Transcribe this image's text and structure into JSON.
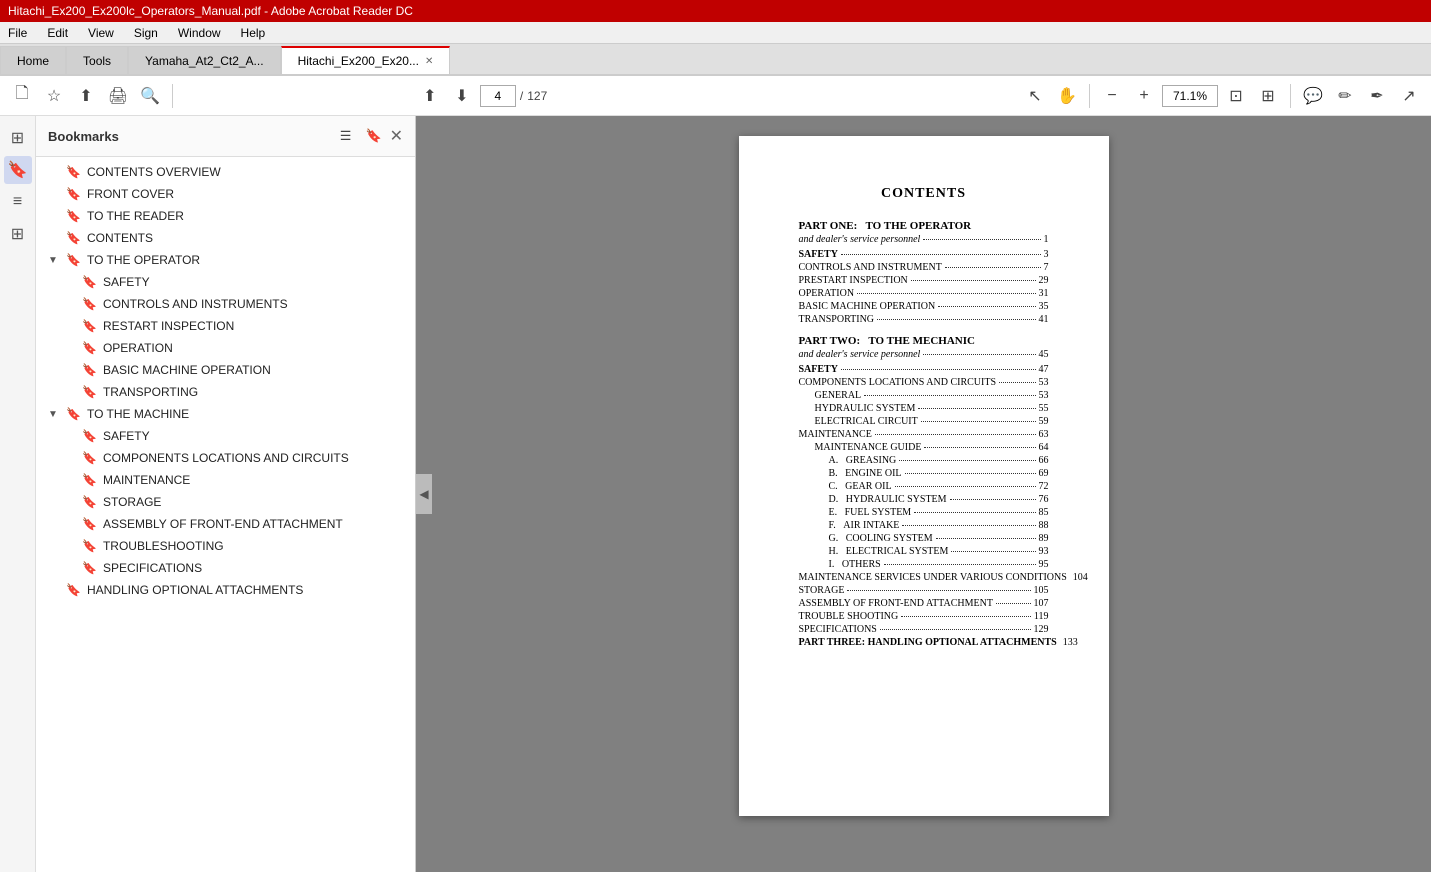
{
  "titlebar": {
    "text": "Hitachi_Ex200_Ex200lc_Operators_Manual.pdf - Adobe Acrobat Reader DC"
  },
  "menubar": {
    "items": [
      "File",
      "Edit",
      "View",
      "Sign",
      "Window",
      "Help"
    ]
  },
  "tabs": [
    {
      "label": "Home",
      "active": false
    },
    {
      "label": "Tools",
      "active": false
    },
    {
      "label": "Yamaha_At2_Ct2_A...",
      "active": false,
      "closeable": false
    },
    {
      "label": "Hitachi_Ex200_Ex20...",
      "active": true,
      "closeable": true
    }
  ],
  "toolbar": {
    "page_current": "4",
    "page_total": "127",
    "zoom": "71.1%",
    "nav_separator": "/"
  },
  "bookmarks": {
    "title": "Bookmarks",
    "items": [
      {
        "label": "CONTENTS OVERVIEW",
        "level": 0,
        "expand": false,
        "icon": "bookmark"
      },
      {
        "label": "FRONT COVER",
        "level": 0,
        "expand": false,
        "icon": "bookmark"
      },
      {
        "label": "TO THE READER",
        "level": 0,
        "expand": false,
        "icon": "bookmark"
      },
      {
        "label": "CONTENTS",
        "level": 0,
        "expand": false,
        "icon": "bookmark"
      },
      {
        "label": "TO THE OPERATOR",
        "level": 0,
        "expand": true,
        "icon": "bookmark"
      },
      {
        "label": "SAFETY",
        "level": 1,
        "expand": false,
        "icon": "bookmark"
      },
      {
        "label": "CONTROLS AND INSTRUMENTS",
        "level": 1,
        "expand": false,
        "icon": "bookmark"
      },
      {
        "label": "RESTART INSPECTION",
        "level": 1,
        "expand": false,
        "icon": "bookmark"
      },
      {
        "label": "OPERATION",
        "level": 1,
        "expand": false,
        "icon": "bookmark"
      },
      {
        "label": "BASIC MACHINE OPERATION",
        "level": 1,
        "expand": false,
        "icon": "bookmark"
      },
      {
        "label": "TRANSPORTING",
        "level": 1,
        "expand": false,
        "icon": "bookmark"
      },
      {
        "label": "TO THE MACHINE",
        "level": 0,
        "expand": true,
        "icon": "bookmark"
      },
      {
        "label": "SAFETY",
        "level": 1,
        "expand": false,
        "icon": "bookmark"
      },
      {
        "label": "COMPONENTS LOCATIONS AND CIRCUITS",
        "level": 1,
        "expand": false,
        "icon": "bookmark"
      },
      {
        "label": "MAINTENANCE",
        "level": 1,
        "expand": false,
        "icon": "bookmark"
      },
      {
        "label": "STORAGE",
        "level": 1,
        "expand": false,
        "icon": "bookmark"
      },
      {
        "label": "ASSEMBLY OF FRONT-END ATTACHMENT",
        "level": 1,
        "expand": false,
        "icon": "bookmark"
      },
      {
        "label": "TROUBLESHOOTING",
        "level": 1,
        "expand": false,
        "icon": "bookmark"
      },
      {
        "label": "SPECIFICATIONS",
        "level": 1,
        "expand": false,
        "icon": "bookmark"
      },
      {
        "label": "HANDLING OPTIONAL ATTACHMENTS",
        "level": 0,
        "expand": false,
        "icon": "bookmark"
      }
    ]
  },
  "toc": {
    "title": "CONTENTS",
    "sections": [
      {
        "type": "part_header",
        "label": "PART ONE:",
        "sublabel": "TO THE OPERATOR"
      },
      {
        "type": "part_sub",
        "label": "and dealer's service personnel",
        "dots": true,
        "page": "1"
      },
      {
        "type": "row",
        "label": "SAFETY",
        "dots": true,
        "page": "3",
        "bold": true
      },
      {
        "type": "row",
        "label": "CONTROLS AND INSTRUMENT",
        "dots": true,
        "page": "7"
      },
      {
        "type": "row",
        "label": "PRESTART INSPECTION",
        "dots": true,
        "page": "29"
      },
      {
        "type": "row",
        "label": "OPERATION",
        "dots": true,
        "page": "31"
      },
      {
        "type": "row",
        "label": "BASIC MACHINE OPERATION",
        "dots": true,
        "page": "35"
      },
      {
        "type": "row",
        "label": "TRANSPORTING",
        "dots": true,
        "page": "41"
      },
      {
        "type": "part_header",
        "label": "PART TWO:",
        "sublabel": "TO THE MECHANIC"
      },
      {
        "type": "part_sub",
        "label": "and dealer's service personnel",
        "dots": true,
        "page": "45"
      },
      {
        "type": "row",
        "label": "SAFETY",
        "dots": true,
        "page": "47",
        "bold": true
      },
      {
        "type": "row",
        "label": "COMPONENTS LOCATIONS AND CIRCUITS",
        "dots": true,
        "page": "53"
      },
      {
        "type": "row",
        "label": "GENERAL",
        "dots": true,
        "page": "53",
        "indent": 1
      },
      {
        "type": "row",
        "label": "HYDRAULIC SYSTEM",
        "dots": true,
        "page": "55",
        "indent": 1
      },
      {
        "type": "row",
        "label": "ELECTRICAL CIRCUIT",
        "dots": true,
        "page": "59",
        "indent": 1
      },
      {
        "type": "row",
        "label": "MAINTENANCE",
        "dots": true,
        "page": "63"
      },
      {
        "type": "row",
        "label": "MAINTENANCE GUIDE",
        "dots": true,
        "page": "64",
        "indent": 1
      },
      {
        "type": "row",
        "label": "A.   GREASING",
        "dots": true,
        "page": "66",
        "indent": 2
      },
      {
        "type": "row",
        "label": "B.   ENGINE OIL",
        "dots": true,
        "page": "69",
        "indent": 2
      },
      {
        "type": "row",
        "label": "C.   GEAR OIL",
        "dots": true,
        "page": "72",
        "indent": 2
      },
      {
        "type": "row",
        "label": "D.   HYDRAULIC SYSTEM",
        "dots": true,
        "page": "76",
        "indent": 2
      },
      {
        "type": "row",
        "label": "E.   FUEL SYSTEM",
        "dots": true,
        "page": "85",
        "indent": 2
      },
      {
        "type": "row",
        "label": "F.   AIR INTAKE",
        "dots": true,
        "page": "88",
        "indent": 2
      },
      {
        "type": "row",
        "label": "G.   COOLING SYSTEM",
        "dots": true,
        "page": "89",
        "indent": 2
      },
      {
        "type": "row",
        "label": "H.   ELECTRICAL SYSTEM",
        "dots": true,
        "page": "93",
        "indent": 2
      },
      {
        "type": "row",
        "label": "I.   OTHERS",
        "dots": true,
        "page": "95",
        "indent": 2
      },
      {
        "type": "row",
        "label": "MAINTENANCE SERVICES UNDER VARIOUS CONDITIONS",
        "dots": true,
        "page": "104"
      },
      {
        "type": "row",
        "label": "STORAGE",
        "dots": true,
        "page": "105"
      },
      {
        "type": "row",
        "label": "ASSEMBLY OF FRONT-END ATTACHMENT",
        "dots": true,
        "page": "107"
      },
      {
        "type": "row",
        "label": "TROUBLE SHOOTING",
        "dots": true,
        "page": "119"
      },
      {
        "type": "row",
        "label": "SPECIFICATIONS",
        "dots": true,
        "page": "129"
      },
      {
        "type": "row",
        "label": "PART THREE:  HANDLING OPTIONAL ATTACHMENTS",
        "dots": true,
        "page": "133",
        "bold": true
      }
    ]
  }
}
